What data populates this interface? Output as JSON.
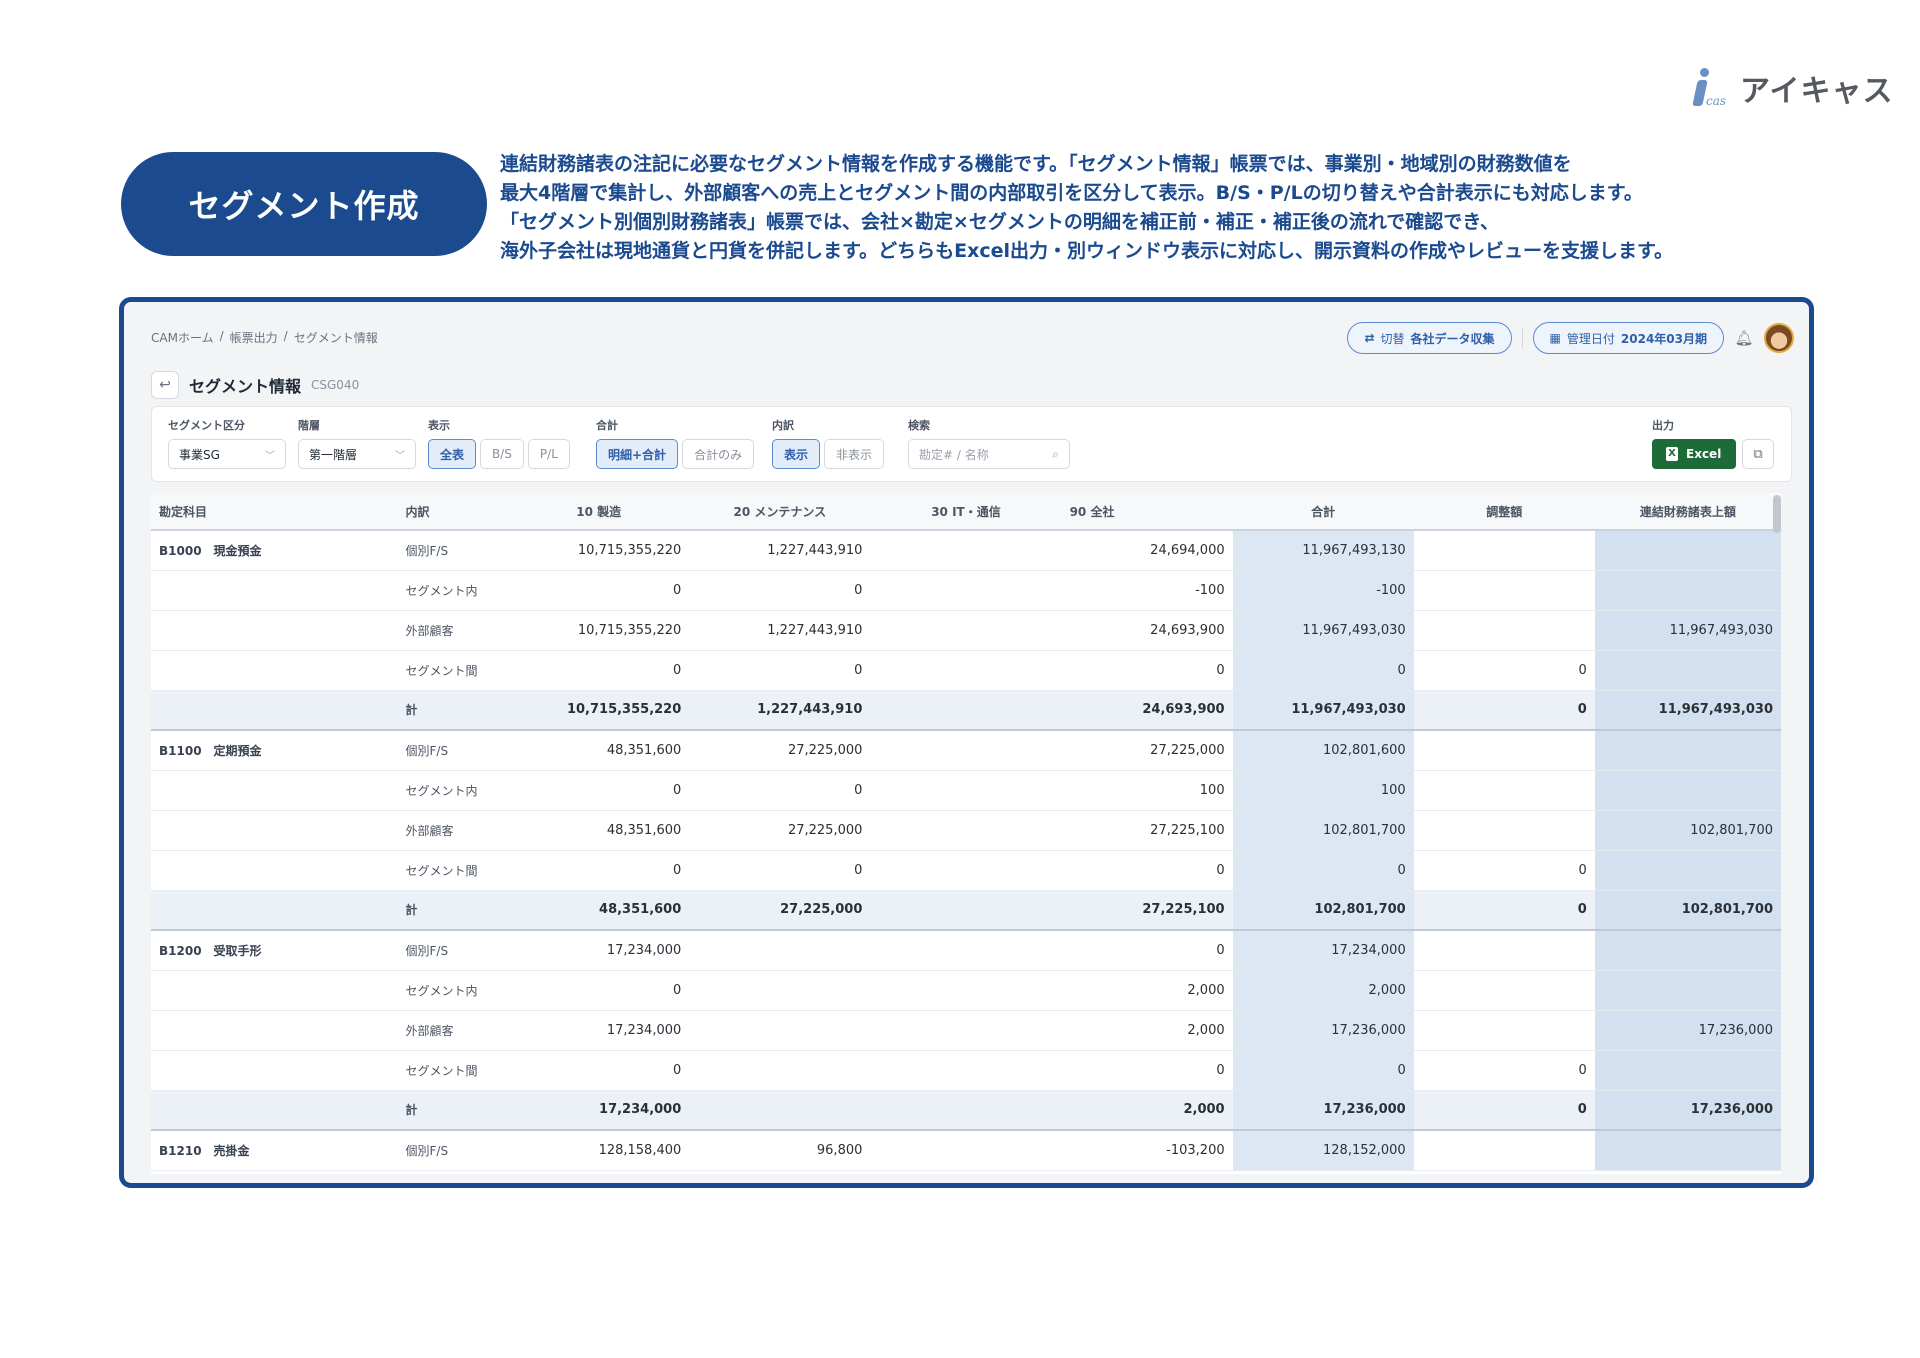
{
  "brand": {
    "logo_text": "アイキャス",
    "logo_mark": "icas"
  },
  "hero": {
    "title": "セグメント作成",
    "lines": [
      "連結財務諸表の注記に必要なセグメント情報を作成する機能です。「セグメント情報」帳票では、事業別・地域別の財務数値を",
      "最大4階層で集計し、外部顧客への売上とセグメント間の内部取引を区分して表示。B/S・P/Lの切り替えや合計表示にも対応します。",
      "「セグメント別個別財務諸表」帳票では、会社×勘定×セグメントの明細を補正前・補正・補正後の流れで確認でき、",
      "海外子会社は現地通貨と円貨を併記します。どちらもExcel出力・別ウィンドウ表示に対応し、開示資料の作成やレビューを支援します。"
    ]
  },
  "topbar": {
    "breadcrumb": [
      "CAMホーム",
      "/",
      "帳票出力",
      "/",
      "セグメント情報"
    ],
    "switch_label": "切替",
    "switch_value": "各社データ収集",
    "date_label": "管理日付",
    "date_value": "2024年03月期"
  },
  "page": {
    "back_icon": "↩",
    "title": "セグメント情報",
    "code": "CSG040"
  },
  "filters": {
    "segment_type": {
      "label": "セグメント区分",
      "value": "事業SG"
    },
    "level": {
      "label": "階層",
      "value": "第一階層"
    },
    "display": {
      "label": "表示",
      "options": [
        "全表",
        "B/S",
        "P/L"
      ],
      "selected": "全表"
    },
    "total": {
      "label": "合計",
      "options": [
        "明細+合計",
        "合計のみ"
      ],
      "selected": "明細+合計"
    },
    "breakdown": {
      "label": "内訳",
      "options": [
        "表示",
        "非表示"
      ],
      "selected": "表示"
    },
    "search": {
      "label": "検索",
      "placeholder": "勘定# / 名称"
    },
    "output": {
      "label": "出力",
      "excel_label": "Excel"
    }
  },
  "table": {
    "columns": [
      "勘定科目",
      "内訳",
      "10 製造",
      "20 メンテナンス",
      "30 IT・通信",
      "90 全社",
      "合計",
      "調整額",
      "連結財務諸表上額"
    ],
    "groups": [
      {
        "account": "B1000　現金預金",
        "rows": [
          {
            "sub": "個別F/S",
            "v": [
              "10,715,355,220",
              "1,227,443,910",
              "",
              "24,694,000",
              "11,967,493,130",
              "",
              ""
            ]
          },
          {
            "sub": "セグメント内",
            "v": [
              "0",
              "0",
              "",
              "-100",
              "-100",
              "",
              ""
            ]
          },
          {
            "sub": "外部顧客",
            "v": [
              "10,715,355,220",
              "1,227,443,910",
              "",
              "24,693,900",
              "11,967,493,030",
              "",
              "11,967,493,030"
            ]
          },
          {
            "sub": "セグメント間",
            "v": [
              "0",
              "0",
              "",
              "0",
              "0",
              "0",
              ""
            ]
          },
          {
            "sub": "計",
            "total": true,
            "v": [
              "10,715,355,220",
              "1,227,443,910",
              "",
              "24,693,900",
              "11,967,493,030",
              "0",
              "11,967,493,030"
            ]
          }
        ]
      },
      {
        "account": "B1100　定期預金",
        "rows": [
          {
            "sub": "個別F/S",
            "v": [
              "48,351,600",
              "27,225,000",
              "",
              "27,225,000",
              "102,801,600",
              "",
              ""
            ]
          },
          {
            "sub": "セグメント内",
            "v": [
              "0",
              "0",
              "",
              "100",
              "100",
              "",
              ""
            ]
          },
          {
            "sub": "外部顧客",
            "v": [
              "48,351,600",
              "27,225,000",
              "",
              "27,225,100",
              "102,801,700",
              "",
              "102,801,700"
            ]
          },
          {
            "sub": "セグメント間",
            "v": [
              "0",
              "0",
              "",
              "0",
              "0",
              "0",
              ""
            ]
          },
          {
            "sub": "計",
            "total": true,
            "v": [
              "48,351,600",
              "27,225,000",
              "",
              "27,225,100",
              "102,801,700",
              "0",
              "102,801,700"
            ]
          }
        ]
      },
      {
        "account": "B1200　受取手形",
        "rows": [
          {
            "sub": "個別F/S",
            "v": [
              "17,234,000",
              "",
              "",
              "0",
              "17,234,000",
              "",
              ""
            ]
          },
          {
            "sub": "セグメント内",
            "v": [
              "0",
              "",
              "",
              "2,000",
              "2,000",
              "",
              ""
            ]
          },
          {
            "sub": "外部顧客",
            "v": [
              "17,234,000",
              "",
              "",
              "2,000",
              "17,236,000",
              "",
              "17,236,000"
            ]
          },
          {
            "sub": "セグメント間",
            "v": [
              "0",
              "",
              "",
              "0",
              "0",
              "0",
              ""
            ]
          },
          {
            "sub": "計",
            "total": true,
            "v": [
              "17,234,000",
              "",
              "",
              "2,000",
              "17,236,000",
              "0",
              "17,236,000"
            ]
          }
        ]
      },
      {
        "account": "B1210　売掛金",
        "rows": [
          {
            "sub": "個別F/S",
            "v": [
              "128,158,400",
              "96,800",
              "",
              "-103,200",
              "128,152,000",
              "",
              ""
            ]
          }
        ]
      }
    ]
  }
}
